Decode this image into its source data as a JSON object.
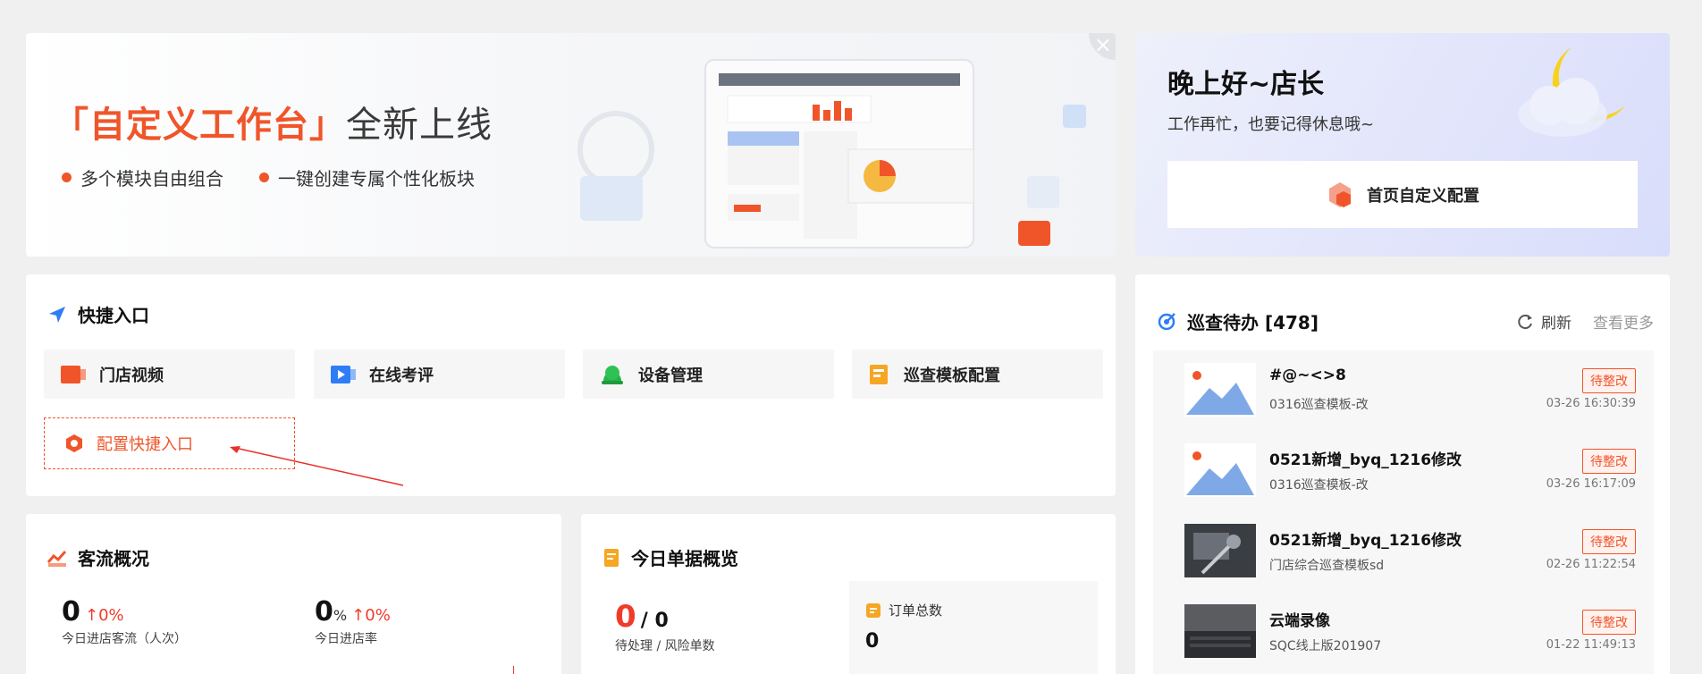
{
  "banner": {
    "title_accent": "「自定义工作台」",
    "title_rest": "全新上线",
    "bullets": [
      "多个模块自由组合",
      "一键创建专属个性化板块"
    ],
    "close_symbol": "×"
  },
  "greeting": {
    "title": "晚上好~店长",
    "subtitle": "工作再忙，也要记得休息哦~",
    "config_button": "首页自定义配置"
  },
  "quick_entry": {
    "title": "快捷入口",
    "items": [
      {
        "label": "门店视频",
        "icon": "video-icon"
      },
      {
        "label": "在线考评",
        "icon": "play-video-icon"
      },
      {
        "label": "设备管理",
        "icon": "device-icon"
      },
      {
        "label": "巡查模板配置",
        "icon": "template-icon"
      }
    ],
    "config_label": "配置快捷入口"
  },
  "customer_flow": {
    "title": "客流概况",
    "stats": [
      {
        "value": "0",
        "unit": "",
        "change": "0%",
        "label": "今日进店客流（人次）"
      },
      {
        "value": "0",
        "unit": "%",
        "change": "0%",
        "label": "今日进店率"
      }
    ]
  },
  "today_orders": {
    "title": "今日单据概览",
    "pending": "0",
    "risk": "/ 0",
    "pending_label": "待处理 / 风险单数",
    "total_label": "订单总数",
    "total_value": "0"
  },
  "patrol_todo": {
    "title": "巡查待办 [478]",
    "refresh": "刷新",
    "more": "查看更多",
    "items": [
      {
        "title": "#@~<>8",
        "subtitle": "0316巡查模板-改",
        "tag": "待整改",
        "time": "03-26 16:30:39",
        "thumb": "placeholder"
      },
      {
        "title": "0521新增_byq_1216修改",
        "subtitle": "0316巡查模板-改",
        "tag": "待整改",
        "time": "03-26 16:17:09",
        "thumb": "placeholder"
      },
      {
        "title": "0521新增_byq_1216修改",
        "subtitle": "门店综合巡查模板sd",
        "tag": "待整改",
        "time": "02-26 11:22:54",
        "thumb": "photo"
      },
      {
        "title": "云端录像",
        "subtitle": "SQC线上版201907",
        "tag": "待整改",
        "time": "01-22 11:49:13",
        "thumb": "photo"
      }
    ]
  },
  "colors": {
    "accent": "#f0552a",
    "blue": "#2f7df6",
    "up": "#f03a2a"
  }
}
